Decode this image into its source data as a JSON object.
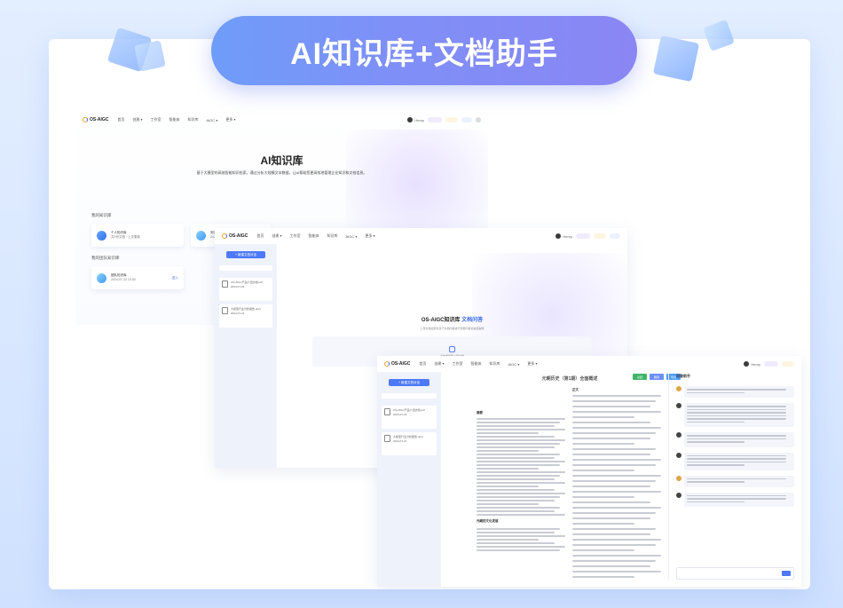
{
  "banner": {
    "title": "AI知识库+文档助手"
  },
  "nav": {
    "logo": "OS-AIGC",
    "items": [
      "首页",
      "创建 ▾",
      "工作室",
      "智能体",
      "知识库",
      "AIGC ▾",
      "更多 ▾"
    ],
    "user": "Henry"
  },
  "kb_page": {
    "title": "AI知识库",
    "subtitle": "基于大模型的高效智能知识检索，通过分析大规模文本数据，让AI帮助您更高效地管理企业知识和文档信息。",
    "my_kb_label": "我的知识库",
    "shared_kb_label": "我的团队知识库",
    "cards": [
      {
        "title": "个人知识库",
        "meta": "共2份文档 · 上次更新"
      },
      {
        "title": "测试知识库",
        "meta": "2024-07-22 09:00",
        "tag": "更多"
      },
      {
        "title": "团队知识库",
        "meta": "2024-07-22 10:30",
        "tag": "进入"
      }
    ]
  },
  "doc_page": {
    "new_button": "+ 新建文档对话",
    "title_main": "OS-AIGC知识库",
    "title_accent": "文档问答",
    "description": "上传文档后即可基于文档内容进行智能问答和总结提炼",
    "upload_text": "点击或拖拽上传文档",
    "files": [
      {
        "name": "OS-AIGC产品介绍文档.pdf",
        "date": "2024-07-22"
      },
      {
        "name": "大模型行业分析报告.docx",
        "date": "2024-07-21"
      }
    ]
  },
  "chat_page": {
    "doc_title": "元朝历史（第1期）全面概述",
    "toolbar": [
      "总结",
      "翻译",
      "导出"
    ],
    "section_headings": [
      "摘要",
      "正文",
      "元朝的文化发展"
    ],
    "chat_title": "问答助手"
  },
  "colors": {
    "accent": "#4d79f6",
    "banner_start": "#6f9cf9",
    "banner_end": "#8a86f4"
  }
}
